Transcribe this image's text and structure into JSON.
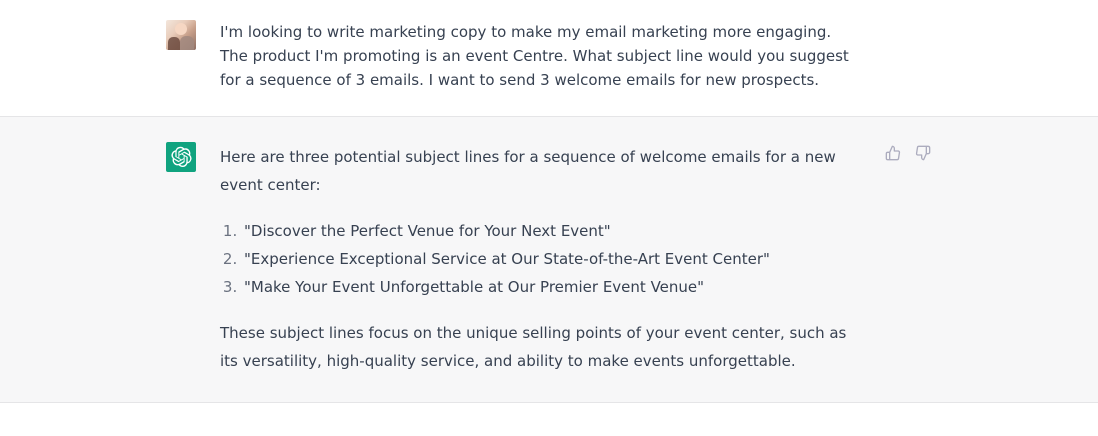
{
  "conversation": {
    "user_message": {
      "text": "I'm looking to write marketing copy to make my email marketing more engaging. The product I'm promoting is an event Centre. What subject line would you suggest for a sequence of 3 emails. I want to send 3 welcome emails for new prospects."
    },
    "assistant_message": {
      "intro": "Here are three potential subject lines for a sequence of welcome emails for a new event center:",
      "items": [
        "\"Discover the Perfect Venue for Your Next Event\"",
        "\"Experience Exceptional Service at Our State-of-the-Art Event Center\"",
        "\"Make Your Event Unforgettable at Our Premier Event Venue\""
      ],
      "outro": "These subject lines focus on the unique selling points of your event center, such as its versatility, high-quality service, and ability to make events unforgettable."
    }
  },
  "icons": {
    "assistant_avatar": "openai-logo-icon",
    "thumbs_up": "thumbs-up-icon",
    "thumbs_down": "thumbs-down-icon"
  },
  "colors": {
    "assistant_bg": "#f7f7f8",
    "brand_green": "#10a37f",
    "text": "#374151"
  }
}
